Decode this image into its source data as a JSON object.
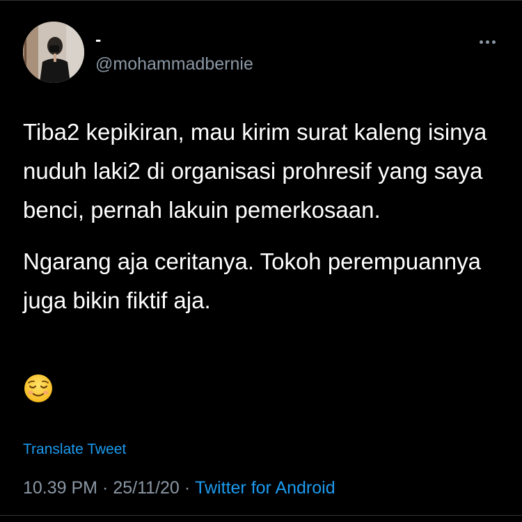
{
  "colors": {
    "background": "#000000",
    "text_primary": "#ffffff",
    "text_secondary": "#8b98a5",
    "link": "#1d9bf0",
    "divider": "#2f3336"
  },
  "author": {
    "display_name": "-",
    "handle": "@mohammadbernie",
    "avatar_icon": "profile-photo"
  },
  "header": {
    "more_icon": "more-horizontal-icon"
  },
  "tweet": {
    "paragraph_1": "Tiba2 kepikiran, mau kirim surat kaleng isinya nuduh laki2 di organisasi prohresif yang saya benci, pernah lakuin pemerkosaan.",
    "paragraph_2": "Ngarang aja ceritanya. Tokoh perempuannya juga bikin fiktif aja.",
    "emoji_icon": "relieved-face-emoji"
  },
  "translate": {
    "label": "Translate Tweet"
  },
  "meta": {
    "time": "10.39 PM",
    "separator": "·",
    "date": "25/11/20",
    "source": "Twitter for Android"
  }
}
